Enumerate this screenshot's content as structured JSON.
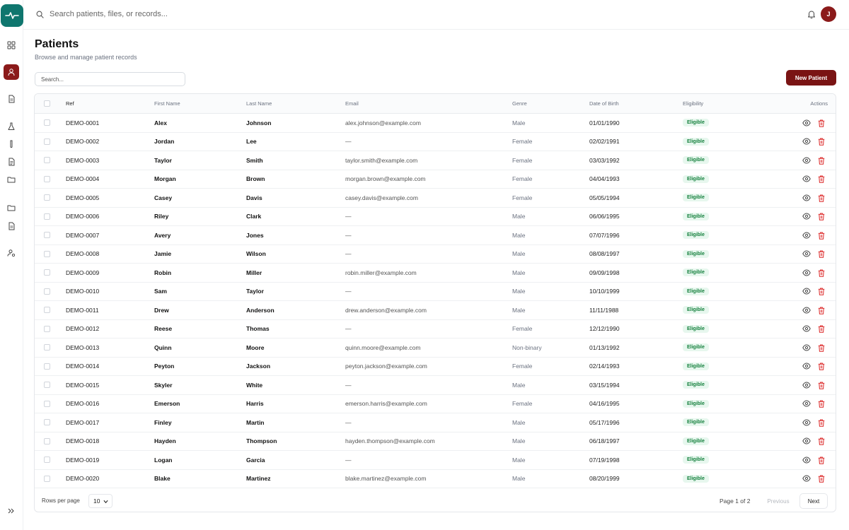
{
  "sidebar": {
    "nav_icons": [
      "dashboard-icon",
      "patients-icon",
      "document-icon",
      "lab-flask-icon",
      "test-tube-icon",
      "report-icon",
      "folder-icon",
      "folder-icon",
      "file-icon",
      "user-settings-icon"
    ],
    "active": "patients-icon"
  },
  "topbar": {
    "search_placeholder": "Search patients, files, or records...",
    "avatar_initial": "J"
  },
  "page": {
    "title": "Patients",
    "subtitle": "Browse and manage patient records",
    "filter_placeholder": "Search...",
    "new_button": "New Patient"
  },
  "table": {
    "headers": {
      "ref": "Ref",
      "first": "First Name",
      "last": "Last Name",
      "email": "Email",
      "genre": "Genre",
      "dob": "Date of Birth",
      "eligibility": "Eligibility",
      "actions": "Actions"
    },
    "rows": [
      {
        "ref": "DEMO-0001",
        "first": "Alex",
        "last": "Johnson",
        "email": "alex.johnson@example.com",
        "genre": "Male",
        "dob": "01/01/1990",
        "eligibility": "Eligible"
      },
      {
        "ref": "DEMO-0002",
        "first": "Jordan",
        "last": "Lee",
        "email": "—",
        "genre": "Female",
        "dob": "02/02/1991",
        "eligibility": "Eligible"
      },
      {
        "ref": "DEMO-0003",
        "first": "Taylor",
        "last": "Smith",
        "email": "taylor.smith@example.com",
        "genre": "Female",
        "dob": "03/03/1992",
        "eligibility": "Eligible"
      },
      {
        "ref": "DEMO-0004",
        "first": "Morgan",
        "last": "Brown",
        "email": "morgan.brown@example.com",
        "genre": "Female",
        "dob": "04/04/1993",
        "eligibility": "Eligible"
      },
      {
        "ref": "DEMO-0005",
        "first": "Casey",
        "last": "Davis",
        "email": "casey.davis@example.com",
        "genre": "Female",
        "dob": "05/05/1994",
        "eligibility": "Eligible"
      },
      {
        "ref": "DEMO-0006",
        "first": "Riley",
        "last": "Clark",
        "email": "—",
        "genre": "Male",
        "dob": "06/06/1995",
        "eligibility": "Eligible"
      },
      {
        "ref": "DEMO-0007",
        "first": "Avery",
        "last": "Jones",
        "email": "—",
        "genre": "Male",
        "dob": "07/07/1996",
        "eligibility": "Eligible"
      },
      {
        "ref": "DEMO-0008",
        "first": "Jamie",
        "last": "Wilson",
        "email": "—",
        "genre": "Male",
        "dob": "08/08/1997",
        "eligibility": "Eligible"
      },
      {
        "ref": "DEMO-0009",
        "first": "Robin",
        "last": "Miller",
        "email": "robin.miller@example.com",
        "genre": "Male",
        "dob": "09/09/1998",
        "eligibility": "Eligible"
      },
      {
        "ref": "DEMO-0010",
        "first": "Sam",
        "last": "Taylor",
        "email": "—",
        "genre": "Male",
        "dob": "10/10/1999",
        "eligibility": "Eligible"
      },
      {
        "ref": "DEMO-0011",
        "first": "Drew",
        "last": "Anderson",
        "email": "drew.anderson@example.com",
        "genre": "Male",
        "dob": "11/11/1988",
        "eligibility": "Eligible"
      },
      {
        "ref": "DEMO-0012",
        "first": "Reese",
        "last": "Thomas",
        "email": "—",
        "genre": "Female",
        "dob": "12/12/1990",
        "eligibility": "Eligible"
      },
      {
        "ref": "DEMO-0013",
        "first": "Quinn",
        "last": "Moore",
        "email": "quinn.moore@example.com",
        "genre": "Non-binary",
        "dob": "01/13/1992",
        "eligibility": "Eligible"
      },
      {
        "ref": "DEMO-0014",
        "first": "Peyton",
        "last": "Jackson",
        "email": "peyton.jackson@example.com",
        "genre": "Female",
        "dob": "02/14/1993",
        "eligibility": "Eligible"
      },
      {
        "ref": "DEMO-0015",
        "first": "Skyler",
        "last": "White",
        "email": "—",
        "genre": "Male",
        "dob": "03/15/1994",
        "eligibility": "Eligible"
      },
      {
        "ref": "DEMO-0016",
        "first": "Emerson",
        "last": "Harris",
        "email": "emerson.harris@example.com",
        "genre": "Female",
        "dob": "04/16/1995",
        "eligibility": "Eligible"
      },
      {
        "ref": "DEMO-0017",
        "first": "Finley",
        "last": "Martin",
        "email": "—",
        "genre": "Male",
        "dob": "05/17/1996",
        "eligibility": "Eligible"
      },
      {
        "ref": "DEMO-0018",
        "first": "Hayden",
        "last": "Thompson",
        "email": "hayden.thompson@example.com",
        "genre": "Male",
        "dob": "06/18/1997",
        "eligibility": "Eligible"
      },
      {
        "ref": "DEMO-0019",
        "first": "Logan",
        "last": "Garcia",
        "email": "—",
        "genre": "Male",
        "dob": "07/19/1998",
        "eligibility": "Eligible"
      },
      {
        "ref": "DEMO-0020",
        "first": "Blake",
        "last": "Martinez",
        "email": "blake.martinez@example.com",
        "genre": "Male",
        "dob": "08/20/1999",
        "eligibility": "Eligible"
      }
    ]
  },
  "pagination": {
    "rows_per_page_label": "Rows per page",
    "rows_per_page_value": "10",
    "page_info": "Page 1 of 2",
    "previous": "Previous",
    "next": "Next"
  },
  "colors": {
    "brand_teal": "#0f766e",
    "accent_maroon": "#7a1414",
    "eligible_bg": "#e7f7ee",
    "eligible_text": "#15803d",
    "delete_red": "#dc2626"
  }
}
